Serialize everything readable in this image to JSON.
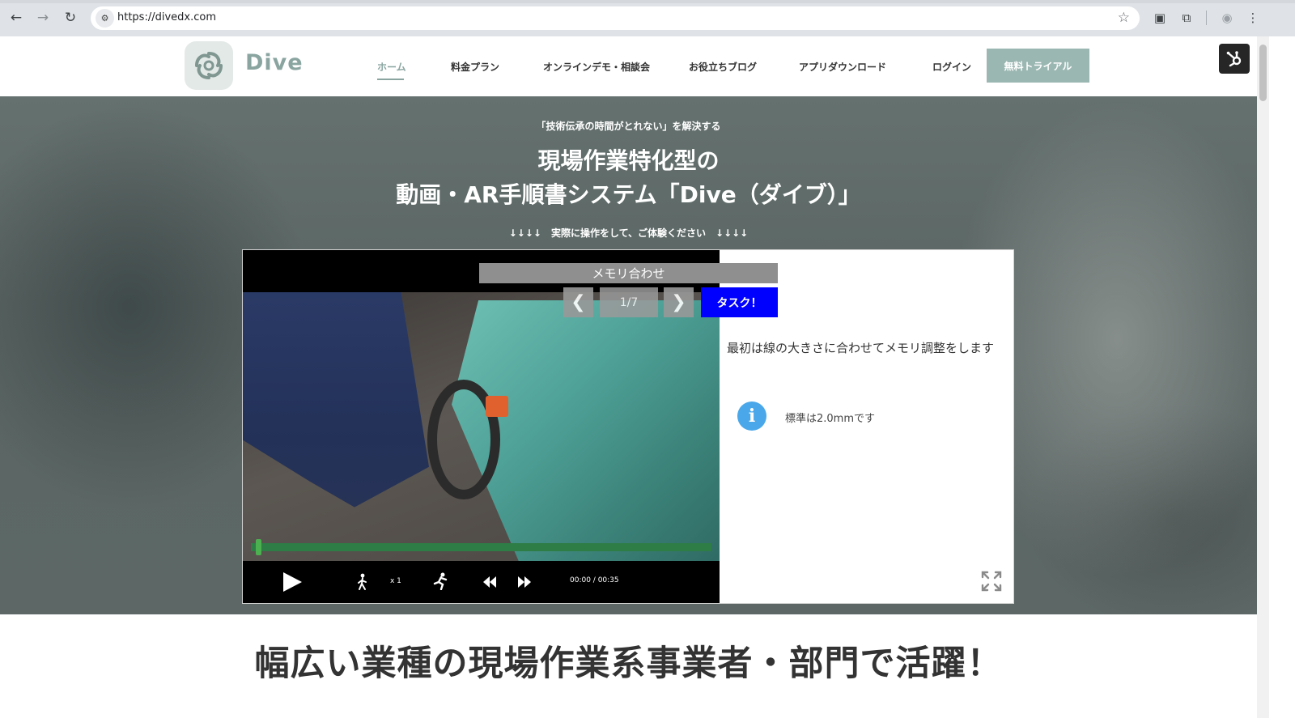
{
  "browser": {
    "url": "https://divedx.com"
  },
  "header": {
    "logo_text": "Dive",
    "nav": [
      {
        "label": "ホーム",
        "active": true
      },
      {
        "label": "料金プラン"
      },
      {
        "label": "オンラインデモ・相談会"
      },
      {
        "label": "お役立ちブログ"
      },
      {
        "label": "アプリダウンロード"
      },
      {
        "label": "ログイン"
      }
    ],
    "cta_label": "無料トライアル"
  },
  "hero": {
    "eyebrow": "「技術伝承の時間がとれない」を解決する",
    "title_line1": "現場作業特化型の",
    "title_line2": "動画・AR手順書システム「Dive（ダイブ）」",
    "hint": "↓↓↓↓　実際に操作をして、ご体験ください　↓↓↓↓"
  },
  "demo": {
    "step_title": "メモリ合わせ",
    "step_counter": "1/7",
    "task_label": "タスク！",
    "description": "最初は線の大きさに合わせてメモリ調整をします",
    "info": "標準は2.0mmです",
    "player": {
      "speed": "x 1",
      "time": "00:00 / 00:35",
      "progress": 0.01
    }
  },
  "section": {
    "title": "幅広い業種の現場作業系事業者・部門で活躍！"
  },
  "colors": {
    "brand": "#8aa5a0",
    "cta": "#9bb7b2",
    "task": "#0000ff",
    "progress": "#2e7d46",
    "info": "#4aa8ea"
  }
}
